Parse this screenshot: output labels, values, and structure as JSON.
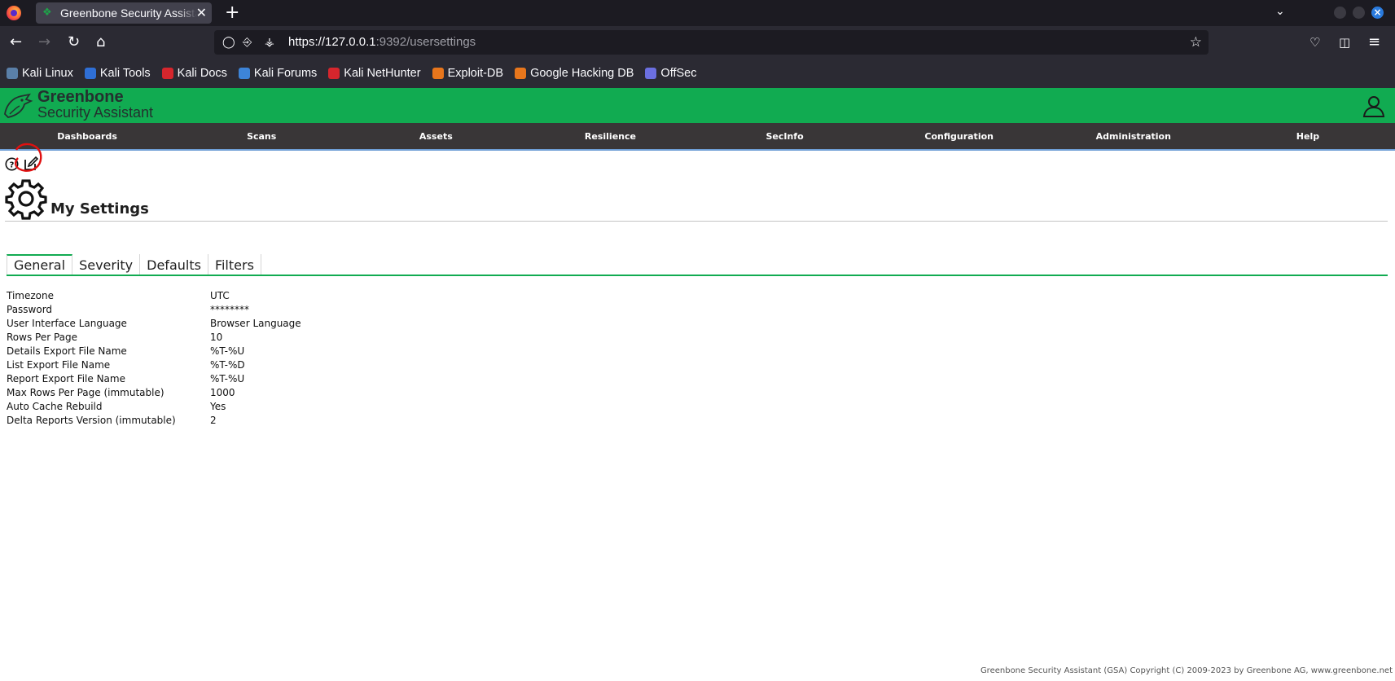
{
  "browser": {
    "tab_title": "Greenbone Security Assistant",
    "url_host": "https://127.0.0.1",
    "url_rest": ":9392/usersettings",
    "bookmarks": [
      {
        "label": "Kali Linux",
        "color": "#5a7fa8"
      },
      {
        "label": "Kali Tools",
        "color": "#2f6fd6"
      },
      {
        "label": "Kali Docs",
        "color": "#d6262d"
      },
      {
        "label": "Kali Forums",
        "color": "#3d84d8"
      },
      {
        "label": "Kali NetHunter",
        "color": "#d6262d"
      },
      {
        "label": "Exploit-DB",
        "color": "#e8761c"
      },
      {
        "label": "Google Hacking DB",
        "color": "#e8761c"
      },
      {
        "label": "OffSec",
        "color": "#6b6fe0"
      }
    ]
  },
  "app": {
    "brand_line1": "Greenbone",
    "brand_line2": "Security Assistant",
    "accent": "#11ab51",
    "menu": [
      "Dashboards",
      "Scans",
      "Assets",
      "Resilience",
      "SecInfo",
      "Configuration",
      "Administration",
      "Help"
    ]
  },
  "page": {
    "title": "My Settings",
    "tabs": [
      "General",
      "Severity",
      "Defaults",
      "Filters"
    ],
    "active_tab": "General",
    "settings": [
      {
        "label": "Timezone",
        "value": "UTC"
      },
      {
        "label": "Password",
        "value": "********"
      },
      {
        "label": "User Interface Language",
        "value": "Browser Language"
      },
      {
        "label": "Rows Per Page",
        "value": "10"
      },
      {
        "label": "Details Export File Name",
        "value": "%T-%U"
      },
      {
        "label": "List Export File Name",
        "value": "%T-%D"
      },
      {
        "label": "Report Export File Name",
        "value": "%T-%U"
      },
      {
        "label": "Max Rows Per Page (immutable)",
        "value": "1000"
      },
      {
        "label": "Auto Cache Rebuild",
        "value": "Yes"
      },
      {
        "label": "Delta Reports Version (immutable)",
        "value": "2"
      }
    ]
  },
  "footer": {
    "text": "Greenbone Security Assistant (GSA) Copyright (C) 2009-2023 by Greenbone AG, www.greenbone.net"
  }
}
